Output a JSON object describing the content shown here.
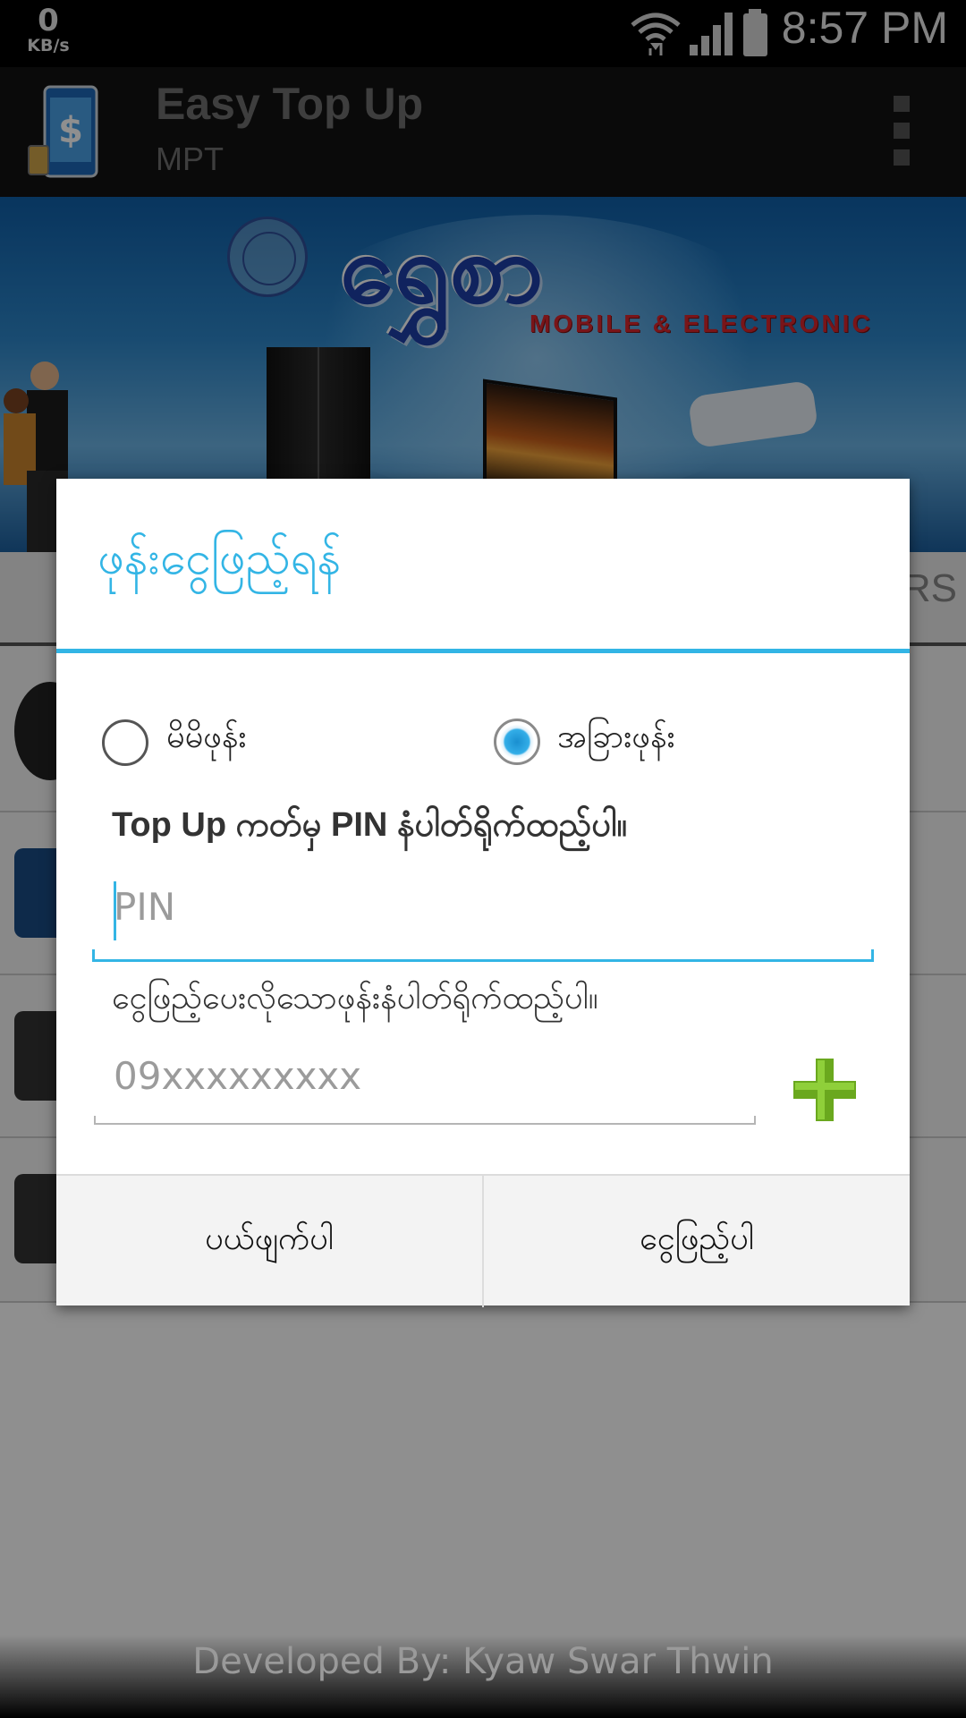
{
  "status_bar": {
    "speed_value": "0",
    "speed_unit": "KB/s",
    "time": "8:57 PM",
    "icons": [
      "wifi-icon",
      "signal-icon",
      "battery-icon"
    ]
  },
  "app_bar": {
    "title": "Easy Top Up",
    "subtitle": "MPT",
    "icons": [
      "app-icon",
      "overflow-menu-icon"
    ]
  },
  "banner": {
    "logo_text": "ရွှေစာ",
    "tagline": "MOBILE & ELECTRONIC"
  },
  "background": {
    "tab_partial": "ERS"
  },
  "dialog": {
    "title": "ဖုန်းငွေဖြည့်ရန်",
    "radio_options": [
      {
        "label": "မိမိဖုန်း",
        "checked": false
      },
      {
        "label": "အခြားဖုန်း",
        "checked": true
      }
    ],
    "pin_label": "Top Up ကတ်မှ PIN နံပါတ်ရိုက်ထည့်ပါ။",
    "pin_placeholder": "PIN",
    "phone_label": "ငွေဖြည့်ပေးလိုသောဖုန်းနံပါတ်ရိုက်ထည့်ပါ။",
    "phone_placeholder": "09xxxxxxxxx",
    "cancel_label": "ပယ်ဖျက်ပါ",
    "confirm_label": "ငွေဖြည့်ပါ",
    "accent_color": "#33b5e5",
    "add_icon": "plus-icon",
    "add_icon_color": "#6aa81e"
  },
  "footer": {
    "credit": "Developed By: Kyaw Swar Thwin"
  }
}
